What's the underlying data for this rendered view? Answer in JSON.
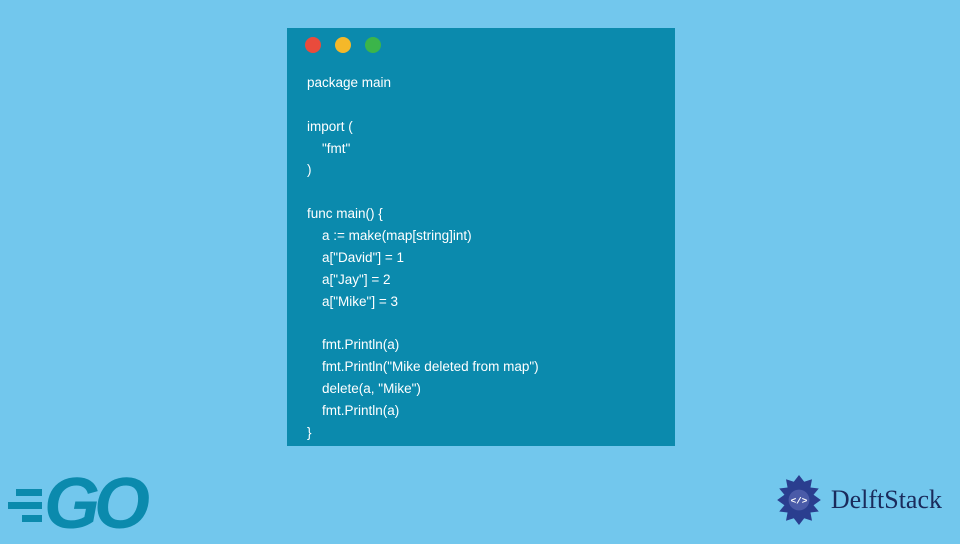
{
  "code": {
    "line1": "package main",
    "line2": "",
    "line3": "import (",
    "line4": "    \"fmt\"",
    "line5": ")",
    "line6": "",
    "line7": "func main() {",
    "line8": "    a := make(map[string]int)",
    "line9": "    a[\"David\"] = 1",
    "line10": "    a[\"Jay\"] = 2",
    "line11": "    a[\"Mike\"] = 3",
    "line12": "",
    "line13": "    fmt.Println(a)",
    "line14": "    fmt.Println(\"Mike deleted from map\")",
    "line15": "    delete(a, \"Mike\")",
    "line16": "    fmt.Println(a)",
    "line17": "}"
  },
  "logos": {
    "go": "GO",
    "delft": "DelftStack"
  }
}
